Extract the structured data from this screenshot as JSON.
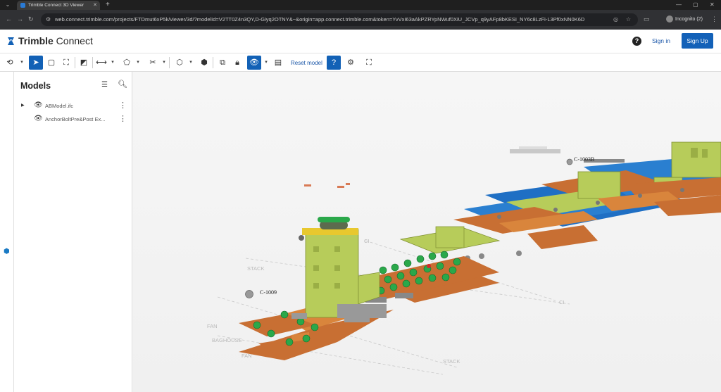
{
  "browser": {
    "tab_title": "Trimble Connect 3D Viewer",
    "url": "web.connect.trimble.com/projects/FTDmut6xP5k/viewer/3d/?modelId=V2TT0Z4n3QY,D-Giyq2OTNY&~&origin=app.connect.trimble.com&token=YvVxI63aAkPZRYpNWuf0XiU_JCVp_q9yAFp8bKESI_NY6c8LzFi-L3Pf0xNN0K6D",
    "profile_label": "Incognito (2)"
  },
  "header": {
    "brand_bold": "Trimble",
    "brand_light": " Connect",
    "sign_in_label": "Sign in",
    "sign_up_label": "Sign Up"
  },
  "toolbar": {
    "reset_label": "Reset model"
  },
  "models_panel": {
    "title": "Models",
    "items": [
      {
        "name": "ABModel.ifc"
      },
      {
        "name": "AnchorBoltPre&Post Ex..."
      }
    ]
  },
  "viewer": {
    "labels": [
      "C-1009",
      "C-1003B",
      "STACK",
      "FAN",
      "BAGHOUSE",
      "CI",
      "FAN",
      "STACK",
      "CI"
    ]
  },
  "colors": {
    "accent": "#1361b8",
    "model_green": "#b7cc5a",
    "model_blue": "#1f6fc4",
    "model_orange": "#c86f33"
  }
}
